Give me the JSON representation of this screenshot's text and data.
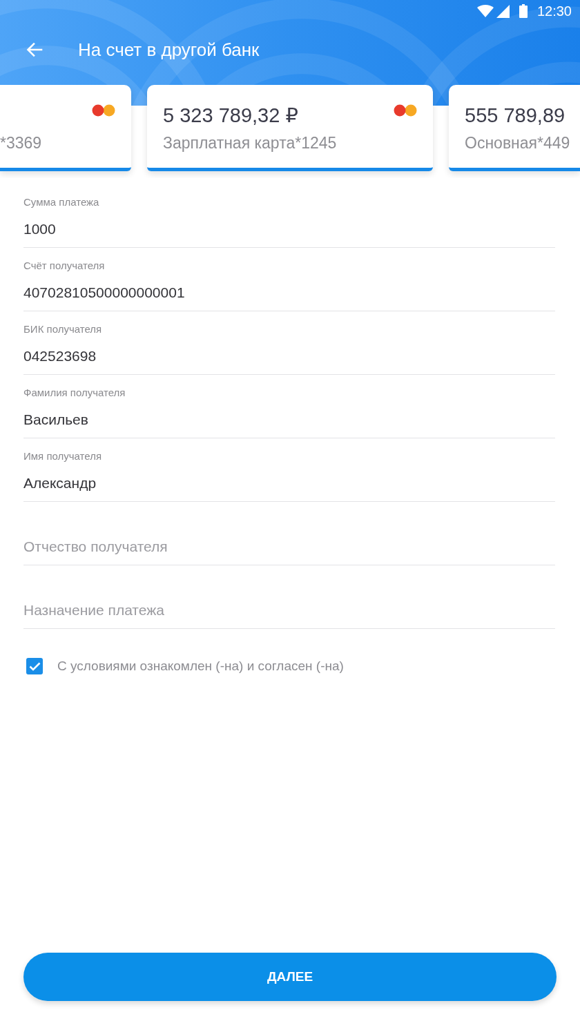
{
  "status_bar": {
    "time": "12:30"
  },
  "toolbar": {
    "title": "На счет в другой банк"
  },
  "cards": [
    {
      "name": "*3369",
      "logo": true
    },
    {
      "amount": "5 323 789,32 ₽",
      "name": "Зарплатная карта*1245",
      "logo": true
    },
    {
      "amount": "555 789,89",
      "name": "Основная*449",
      "logo": false
    }
  ],
  "fields": [
    {
      "label": "Сумма платежа",
      "value": "1000"
    },
    {
      "label": "Счёт получателя",
      "value": "40702810500000000001"
    },
    {
      "label": "БИК получателя",
      "value": "042523698"
    },
    {
      "label": "Фамилия получателя",
      "value": "Васильев"
    },
    {
      "label": "Имя получателя",
      "value": "Александр"
    },
    {
      "placeholder": "Отчество получателя"
    },
    {
      "placeholder": "Назначение платежа"
    }
  ],
  "agreement": {
    "checked": true,
    "text": "С условиями ознакомлен (-на) и согласен (-на)"
  },
  "next_button": {
    "label": "ДАЛЕЕ"
  }
}
